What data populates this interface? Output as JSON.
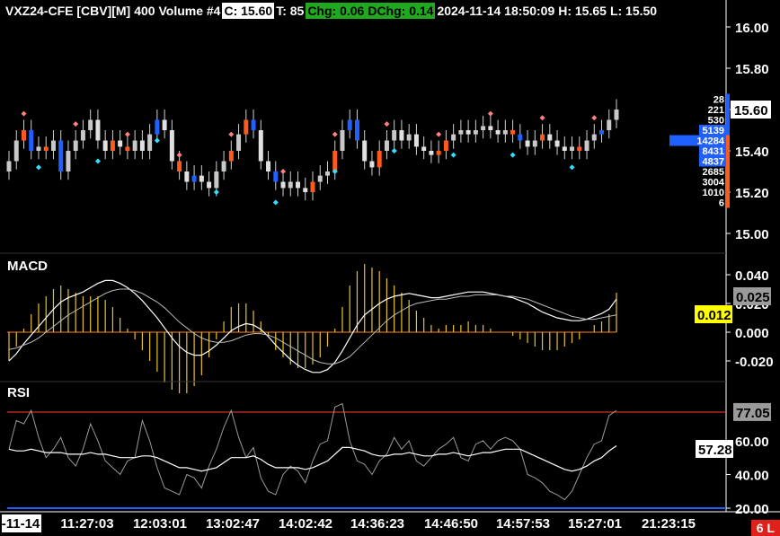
{
  "header": {
    "symbol": "VXZ24-CFE [CBV][M]",
    "chart_desc": "400 Volume #4",
    "close": "C: 15.60",
    "trades": "T: 85",
    "chg": "Chg: 0.06",
    "dchg": "DChg: 0.14",
    "datetime": "2024-11-14 18:50:09",
    "high": "H: 15.65",
    "low": "L: 15.50"
  },
  "colors": {
    "up": "#c8c8c8",
    "down": "#e0e0e0",
    "blue": "#2060ff",
    "orange": "#ff5a1e",
    "macd_hist": "#e6c428",
    "rsi_top": "#ff4030",
    "rsi_bottom": "#2060ff"
  },
  "corner_label": "6 L",
  "chart_data": [
    {
      "type": "candlestick",
      "ylim": [
        15.0,
        16.0
      ],
      "y_ticks": [
        "16.00",
        "15.80",
        "15.60",
        "15.40",
        "15.20",
        "15.00"
      ],
      "last_price": "15.60",
      "close": [
        15.35,
        15.45,
        15.5,
        15.4,
        15.42,
        15.4,
        15.45,
        15.3,
        15.4,
        15.45,
        15.5,
        15.55,
        15.45,
        15.4,
        15.45,
        15.42,
        15.4,
        15.45,
        15.4,
        15.48,
        15.55,
        15.5,
        15.35,
        15.3,
        15.25,
        15.28,
        15.25,
        15.22,
        15.3,
        15.35,
        15.4,
        15.48,
        15.55,
        15.5,
        15.35,
        15.3,
        15.25,
        15.22,
        15.25,
        15.22,
        15.2,
        15.25,
        15.28,
        15.3,
        15.4,
        15.5,
        15.55,
        15.45,
        15.35,
        15.32,
        15.4,
        15.45,
        15.5,
        15.45,
        15.48,
        15.42,
        15.4,
        15.38,
        15.4,
        15.45,
        15.48,
        15.5,
        15.48,
        15.5,
        15.52,
        15.5,
        15.48,
        15.5,
        15.48,
        15.45,
        15.42,
        15.45,
        15.48,
        15.45,
        15.42,
        15.4,
        15.42,
        15.4,
        15.45,
        15.48,
        15.5,
        15.55,
        15.6
      ],
      "price_ladder": {
        "volumes": [
          "28",
          "221",
          "530",
          "5139",
          "14284",
          "8431",
          "4837",
          "2685",
          "3004",
          "1010",
          "6"
        ],
        "prices": [
          "15.65",
          "15.60",
          "15.55",
          "15.50",
          "15.45",
          "15.40",
          "15.35",
          "15.30",
          "15.25",
          "15.20",
          "15.15"
        ]
      }
    },
    {
      "type": "line",
      "title": "MACD",
      "ylim": [
        -0.032,
        0.048
      ],
      "y_ticks": [
        "0.040",
        "0.020",
        "0.000",
        "-0.020"
      ],
      "value_badge": "0.025",
      "hist_badge": "0.012",
      "macd": [
        -0.02,
        -0.015,
        -0.008,
        -0.002,
        0.004,
        0.01,
        0.016,
        0.021,
        0.024,
        0.026,
        0.028,
        0.031,
        0.034,
        0.036,
        0.036,
        0.034,
        0.031,
        0.027,
        0.022,
        0.016,
        0.01,
        0.003,
        -0.004,
        -0.01,
        -0.014,
        -0.016,
        -0.016,
        -0.013,
        -0.009,
        -0.004,
        0.001,
        0.004,
        0.006,
        0.005,
        0.002,
        -0.003,
        -0.009,
        -0.014,
        -0.019,
        -0.023,
        -0.026,
        -0.028,
        -0.028,
        -0.026,
        -0.021,
        -0.013,
        -0.004,
        0.005,
        0.012,
        0.016,
        0.02,
        0.023,
        0.025,
        0.026,
        0.027,
        0.026,
        0.025,
        0.024,
        0.024,
        0.025,
        0.026,
        0.027,
        0.028,
        0.028,
        0.028,
        0.027,
        0.026,
        0.025,
        0.024,
        0.022,
        0.02,
        0.017,
        0.014,
        0.012,
        0.01,
        0.009,
        0.008,
        0.008,
        0.009,
        0.011,
        0.013,
        0.016,
        0.023
      ],
      "signal": [
        -0.012,
        -0.011,
        -0.009,
        -0.007,
        -0.004,
        0.0,
        0.004,
        0.008,
        0.012,
        0.015,
        0.018,
        0.021,
        0.024,
        0.027,
        0.029,
        0.03,
        0.03,
        0.029,
        0.027,
        0.024,
        0.021,
        0.017,
        0.012,
        0.007,
        0.003,
        -0.001,
        -0.004,
        -0.006,
        -0.007,
        -0.007,
        -0.006,
        -0.004,
        -0.002,
        -0.001,
        -0.001,
        -0.002,
        -0.004,
        -0.007,
        -0.01,
        -0.013,
        -0.016,
        -0.019,
        -0.021,
        -0.022,
        -0.022,
        -0.02,
        -0.017,
        -0.012,
        -0.007,
        -0.002,
        0.003,
        0.008,
        0.012,
        0.015,
        0.018,
        0.02,
        0.021,
        0.022,
        0.023,
        0.023,
        0.024,
        0.025,
        0.025,
        0.026,
        0.026,
        0.026,
        0.026,
        0.025,
        0.025,
        0.024,
        0.023,
        0.021,
        0.019,
        0.017,
        0.015,
        0.013,
        0.011,
        0.01,
        0.009,
        0.009,
        0.01,
        0.011,
        0.012
      ]
    },
    {
      "type": "line",
      "title": "RSI",
      "ylim": [
        18,
        82
      ],
      "y_ticks": [
        "60.00",
        "40.00",
        "20.00"
      ],
      "rsi_badge": "77.05",
      "ma_badge": "57.28",
      "top_level": 77,
      "bottom_level": 20,
      "rsi": [
        55,
        72,
        70,
        78,
        62,
        50,
        55,
        62,
        50,
        45,
        55,
        70,
        60,
        48,
        44,
        40,
        48,
        50,
        72,
        60,
        44,
        32,
        30,
        28,
        40,
        38,
        32,
        45,
        55,
        68,
        78,
        62,
        50,
        56,
        38,
        30,
        28,
        40,
        45,
        42,
        35,
        48,
        58,
        60,
        80,
        82,
        60,
        48,
        46,
        40,
        48,
        52,
        62,
        55,
        60,
        48,
        45,
        50,
        55,
        58,
        62,
        50,
        48,
        58,
        60,
        55,
        60,
        62,
        60,
        55,
        40,
        38,
        35,
        30,
        28,
        25,
        30,
        40,
        50,
        58,
        60,
        75,
        78
      ],
      "rsi_ma": [
        55,
        54,
        54,
        55,
        54,
        53,
        53,
        53,
        52,
        52,
        52,
        53,
        52,
        52,
        51,
        50,
        50,
        50,
        51,
        51,
        50,
        48,
        46,
        44,
        44,
        43,
        42,
        43,
        44,
        47,
        50,
        50,
        50,
        51,
        49,
        46,
        44,
        44,
        44,
        44,
        43,
        44,
        46,
        48,
        52,
        56,
        56,
        55,
        54,
        52,
        51,
        51,
        52,
        52,
        53,
        52,
        51,
        51,
        52,
        52,
        53,
        52,
        51,
        52,
        53,
        53,
        54,
        55,
        55,
        55,
        53,
        51,
        49,
        47,
        45,
        43,
        42,
        43,
        45,
        48,
        50,
        54,
        57
      ]
    }
  ],
  "x_axis": {
    "labels": [
      "-11-14",
      "11:27:03",
      "12:03:01",
      "13:02:47",
      "14:02:42",
      "14:36:23",
      "14:46:50",
      "14:57:53",
      "15:27:01",
      "21:23:15"
    ]
  }
}
